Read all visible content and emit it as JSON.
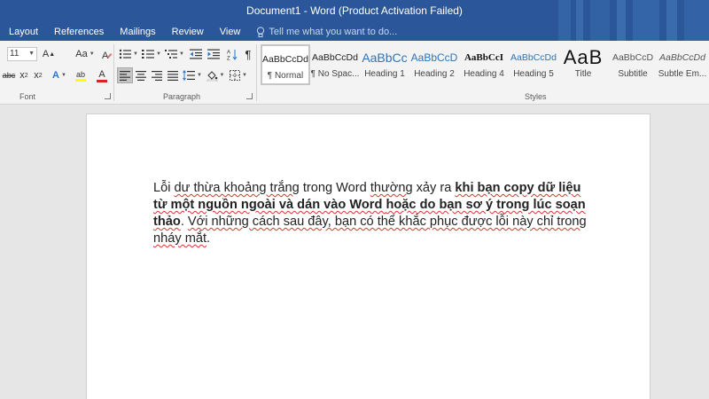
{
  "window": {
    "title": "Document1 - Word (Product Activation Failed)"
  },
  "tabs": [
    "Layout",
    "References",
    "Mailings",
    "Review",
    "View"
  ],
  "tell_me": {
    "placeholder": "Tell me what you want to do..."
  },
  "ribbon": {
    "font_size": "11",
    "font_size_grow_label": "Aa",
    "strikethrough_label": "abc",
    "subscript_label": "x",
    "subscript_sub": "2",
    "superscript_label": "x",
    "superscript_sup": "2",
    "text_effects_label": "A",
    "highlight_label": "ab",
    "font_color_label": "A",
    "font_group_label": "Font",
    "paragraph_group_label": "Paragraph",
    "styles_group_label": "Styles",
    "styles": [
      {
        "preview": "AaBbCcDd",
        "name": "¶ Normal"
      },
      {
        "preview": "AaBbCcDd",
        "name": "¶ No Spac..."
      },
      {
        "preview": "AaBbCc",
        "name": "Heading 1"
      },
      {
        "preview": "AaBbCcD",
        "name": "Heading 2"
      },
      {
        "preview": "AaBbCcI",
        "name": "Heading 4"
      },
      {
        "preview": "AaBbCcDd",
        "name": "Heading 5"
      },
      {
        "preview": "AaB",
        "name": "Title"
      },
      {
        "preview": "AaBbCcD",
        "name": "Subtitle"
      },
      {
        "preview": "AaBbCcDd",
        "name": "Subtle Em..."
      }
    ]
  },
  "document": {
    "p1": "Lỗi ",
    "p2": "dư thừa khoảng trắng",
    "p3": " trong Word ",
    "p4": "thường",
    "p5": " xảy ra ",
    "b1": "khi bạn copy dữ liệu từ một nguồn ngoài và dán vào Word ",
    "b2": "hoặc",
    "b3": " do bạn sơ ý trong lúc soạn thảo",
    "p6": ". ",
    "p7": "Với những cách sau đây, bạn có thể khắc phục được lỗi này chỉ trong nháy mắt",
    "p8": "."
  },
  "colors": {
    "title_bar": "#2b579a",
    "ribbon": "#f3f3f3",
    "squiggle": "#e0302a"
  }
}
